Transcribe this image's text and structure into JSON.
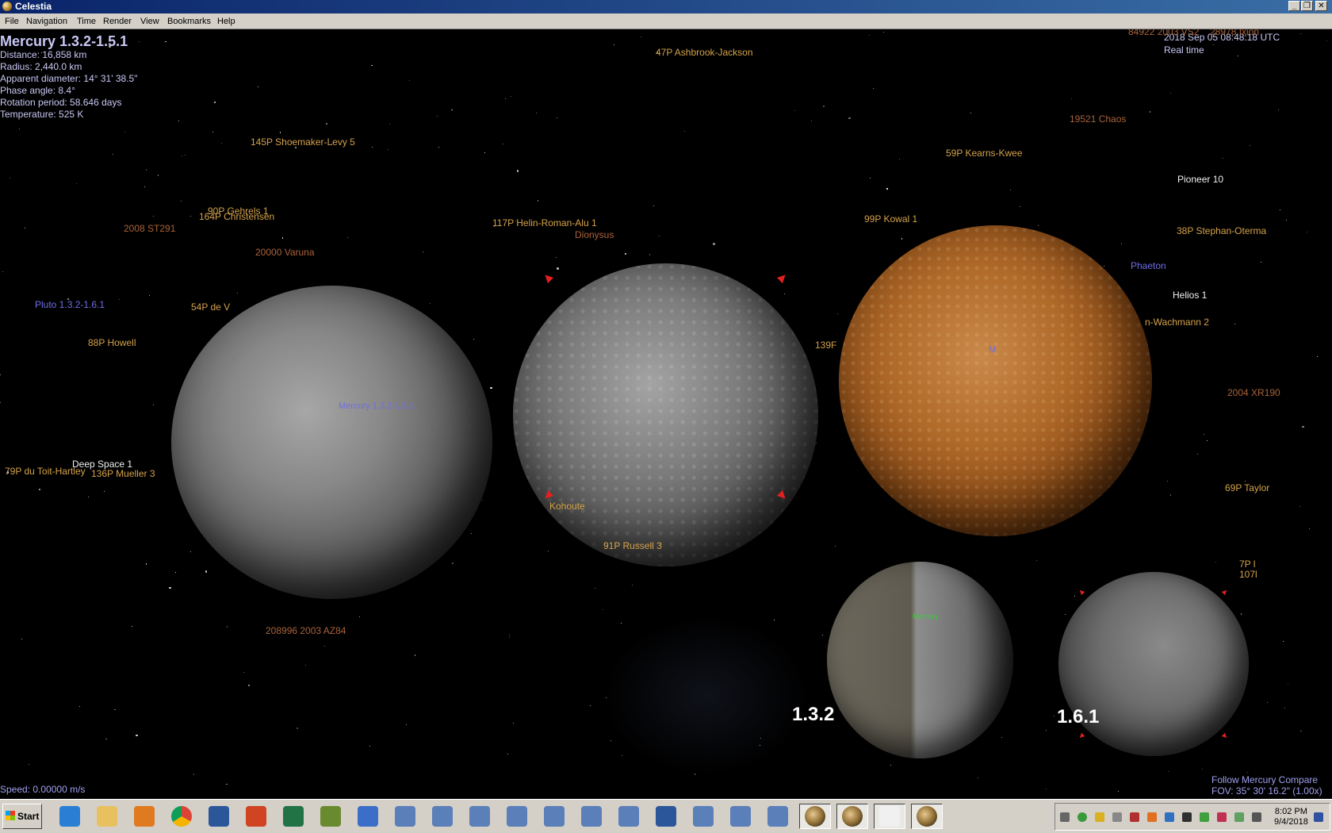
{
  "window": {
    "title": "Celestia",
    "min_icon": "minimize-icon",
    "max_icon": "restore-icon",
    "close_icon": "close-icon"
  },
  "menu": [
    "File",
    "Navigation",
    "Time",
    "Render",
    "View",
    "Bookmarks",
    "Help"
  ],
  "info": {
    "name": "Mercury 1.3.2-1.5.1",
    "distance": "Distance: 16,858 km",
    "radius": "Radius: 2,440.0 km",
    "apparent": "Apparent diameter: 14° 31' 38.5\"",
    "phase": "Phase angle: 8.4°",
    "rotation": "Rotation period: 58.646 days",
    "temperature": "Temperature: 525 K"
  },
  "time": {
    "date": "2018 Sep 05 08:48:18 UTC",
    "mode": "Real time"
  },
  "labels": {
    "l_84922": "84922 2003 VS2",
    "l_ixion": "28978 Ixion",
    "l_47p": "47P Ashbrook-Jackson",
    "l_145p": "145P Shoemaker-Levy 5",
    "l_19521": "19521 Chaos",
    "l_59p": "59P Kearns-Kwee",
    "l_pioneer": "Pioneer 10",
    "l_90p": "90P Gehrels 1",
    "l_164p": "164P Christensen",
    "l_2008": "2008 ST291",
    "l_117p": "117P Helin-Roman-Alu 1",
    "l_dionysus": "Dionysus",
    "l_99p": "99P Kowal 1",
    "l_38p": "38P Stephan-Oterma",
    "l_varuna": "20000 Varuna",
    "l_phaeton": "Phaeton",
    "l_pluto": "Pluto 1.3.2-1.6.1",
    "l_54p": "54P de V",
    "l_helios": "Helios 1",
    "l_wachmann": "n-Wachmann 2",
    "l_88p": "88P Howell",
    "l_139p": "139F",
    "l_mercury_label": "Mercury 1.3.2-1.5.1",
    "l_m": "M",
    "l_2004": "2004 XR190",
    "l_ds1": "Deep Space 1",
    "l_79p": "79P du Toit-Hartley",
    "l_136p": "136P Mueller 3",
    "l_69p": "69P Taylor",
    "l_kohoutek": "Kohoute",
    "l_91p": "91P Russell 3",
    "l_7p": "7P l",
    "l_107": "107l",
    "l_mercury_small": "Mercury",
    "l_208996": "208996 2003 AZ84"
  },
  "versions": {
    "left": "1.3.2",
    "right": "1.6.1"
  },
  "status": {
    "speed": "Speed: 0.00000 m/s",
    "follow": "Follow Mercury Compare",
    "fov": "FOV: 35° 30' 16.2\" (1.00x)"
  },
  "taskbar": {
    "start": "Start",
    "apps": [
      "ie-icon",
      "explorer-icon",
      "media-player-icon",
      "chrome-icon",
      "word-icon",
      "powerpoint-icon",
      "excel-icon",
      "publisher-icon",
      "wordpad-icon",
      "doc-icon",
      "doc-icon",
      "doc-icon",
      "doc-icon",
      "doc-icon",
      "doc-icon",
      "doc-icon",
      "word-icon",
      "doc-icon",
      "doc-icon",
      "doc-icon",
      "celestia-icon",
      "celestia-icon",
      "notepad-icon",
      "celestia-icon"
    ],
    "clock_time": "8:02 PM",
    "clock_date": "9/4/2018"
  }
}
